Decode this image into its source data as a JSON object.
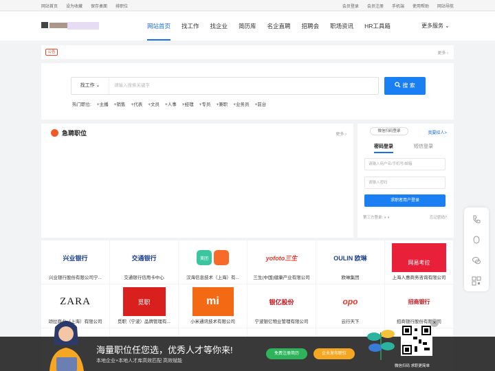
{
  "topbar": {
    "left": [
      "网站首页",
      "设为收藏",
      "保存桌面",
      "排职位"
    ],
    "right": [
      "会员登录",
      "会员注册",
      "手机端",
      "使用帮助",
      "网站导航"
    ]
  },
  "nav": {
    "items": [
      "网站首页",
      "找工作",
      "找企业",
      "简历库",
      "名企直聘",
      "招聘会",
      "职场资讯",
      "HR工具箱"
    ],
    "more": "更多服务"
  },
  "notice": {
    "tag": "公告",
    "more": "更多"
  },
  "search": {
    "type": "找工作",
    "placeholder": "请输入搜索关键字",
    "button": "搜 索",
    "hot_label": "热门职位:",
    "hot": [
      "+主播",
      "+销售",
      "+代表",
      "+文员",
      "+人事",
      "+经理",
      "+专员",
      "+兼职",
      "+业务员",
      "+前台"
    ]
  },
  "jobs": {
    "title": "急聘职位",
    "more": "更多"
  },
  "login": {
    "wechat": "微信扫码登录",
    "recruit": "我要招人>",
    "tab_pwd": "密码登录",
    "tab_sms": "短信登录",
    "user_ph": "请输入用户名/手机号/邮箱",
    "pwd_ph": "请输入密码",
    "button": "求职者用户登录",
    "third": "第三方登录:",
    "forgot": "忘记密码?"
  },
  "companies": [
    {
      "name": "兴业银行股份有限公司宁...",
      "logo": "兴业银行"
    },
    {
      "name": "交通银行信用卡中心",
      "logo": "交通银行"
    },
    {
      "name": "汉海信息技术（上海）有...",
      "logo": "美团"
    },
    {
      "name": "三生(中国)健康产业有限公司",
      "logo": "yofoto三生"
    },
    {
      "name": "欧琳集团",
      "logo": "OULIN 欧琳"
    },
    {
      "name": "上海人惠商务咨询有限公司",
      "logo": "网易考拉"
    },
    {
      "name": "颂拉商业（上海）有限公司",
      "logo": "ZARA"
    },
    {
      "name": "觅职（宁波）品牌管理有...",
      "logo": "觅职"
    },
    {
      "name": "小米通讯技术有限公司",
      "logo": "mi"
    },
    {
      "name": "宁波银亿物业管理有限公司",
      "logo": "银亿股份"
    },
    {
      "name": "云行天下",
      "logo": "opo"
    },
    {
      "name": "招商银行股份有限公司",
      "logo": "招商银行"
    }
  ],
  "banner": {
    "title": "海量职位任您选，优秀人才等你来!",
    "sub": "本地企业+本地人才库高效匹配 高效赋能",
    "btn_reg": "免费注册简历",
    "btn_pub": "企业发布职位",
    "qr_text": "微信扫码 求职更简单"
  },
  "colors": {
    "accent": "#1a7ff2",
    "orange": "#f05a28"
  }
}
